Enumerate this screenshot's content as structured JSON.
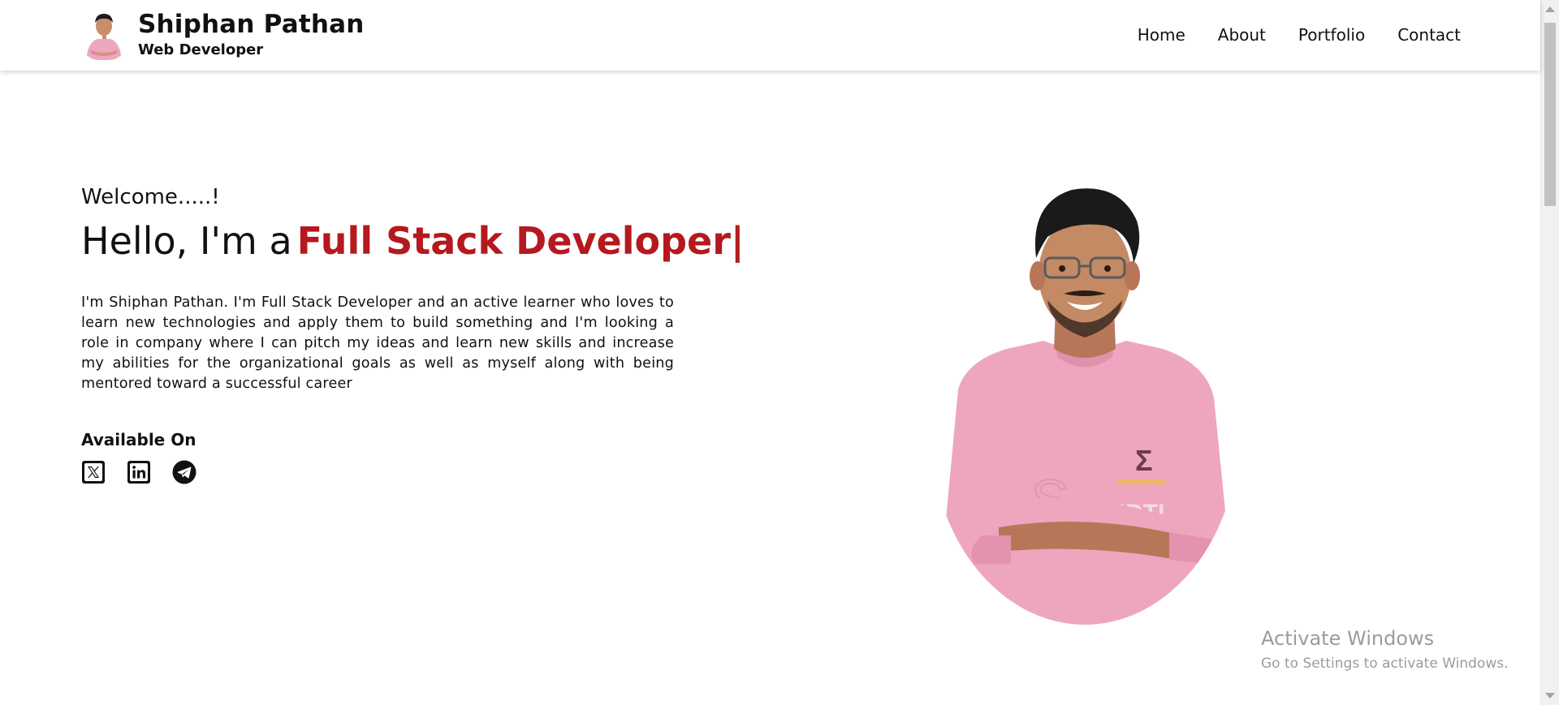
{
  "header": {
    "name": "Shiphan Pathan",
    "role": "Web Developer",
    "nav": [
      {
        "label": "Home"
      },
      {
        "label": "About"
      },
      {
        "label": "Portfolio"
      },
      {
        "label": "Contact"
      }
    ]
  },
  "hero": {
    "welcome": "Welcome.....!",
    "greeting": "Hello, I'm a",
    "title_accent": "Full Stack Developer",
    "cursor": "|",
    "bio": "I'm Shiphan Pathan. I'm Full Stack Developer and an active learner who loves to learn new technologies and apply them to build something and I'm looking a role in company where I can pitch my ideas and learn new skills and increase my abilities for the organizational goals as well as myself along with being mentored toward a successful career",
    "available_on": "Available On",
    "socials": [
      {
        "icon": "x-twitter-icon"
      },
      {
        "icon": "linkedin-icon"
      },
      {
        "icon": "telegram-icon"
      }
    ]
  },
  "watermark": {
    "title": "Activate Windows",
    "subtitle": "Go to Settings to activate Windows."
  },
  "colors": {
    "accent": "#b5191e",
    "shirt": "#eea6be",
    "text": "#111111"
  }
}
